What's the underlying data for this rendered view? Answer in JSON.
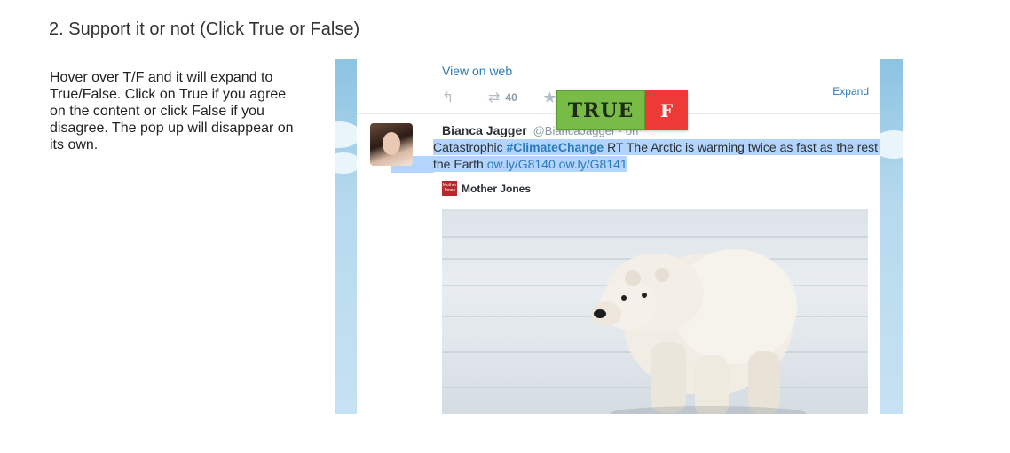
{
  "question": {
    "title": "2. Support it or not (Click True or False)",
    "instructions": "Hover over T/F and it will expand to True/False. Click on True if you agree on the content or click False if you disagree. The pop up will disappear on its own."
  },
  "tweet": {
    "view_on_web": "View on web",
    "retweet_count": "40",
    "expand_label": "Expand",
    "author_name": "Bianca Jagger",
    "author_handle": "@BiancaJagger · on",
    "text_prefix": "Catastrophic ",
    "hashtag": "#ClimateChange",
    "text_body": " RT The Arctic is warming twice as fast as the rest of the Earth ",
    "link1": "ow.ly/G8140",
    "link2": "ow.ly/G8141",
    "source_logo_text": "Mother Jones",
    "source_name": "Mother Jones",
    "icons": {
      "reply": "reply-icon",
      "retweet": "retweet-icon",
      "favorite": "star-icon"
    }
  },
  "popup": {
    "true_label": "TRUE",
    "false_label": "F",
    "colors": {
      "true": "#79bb47",
      "false": "#ee3a36"
    }
  }
}
